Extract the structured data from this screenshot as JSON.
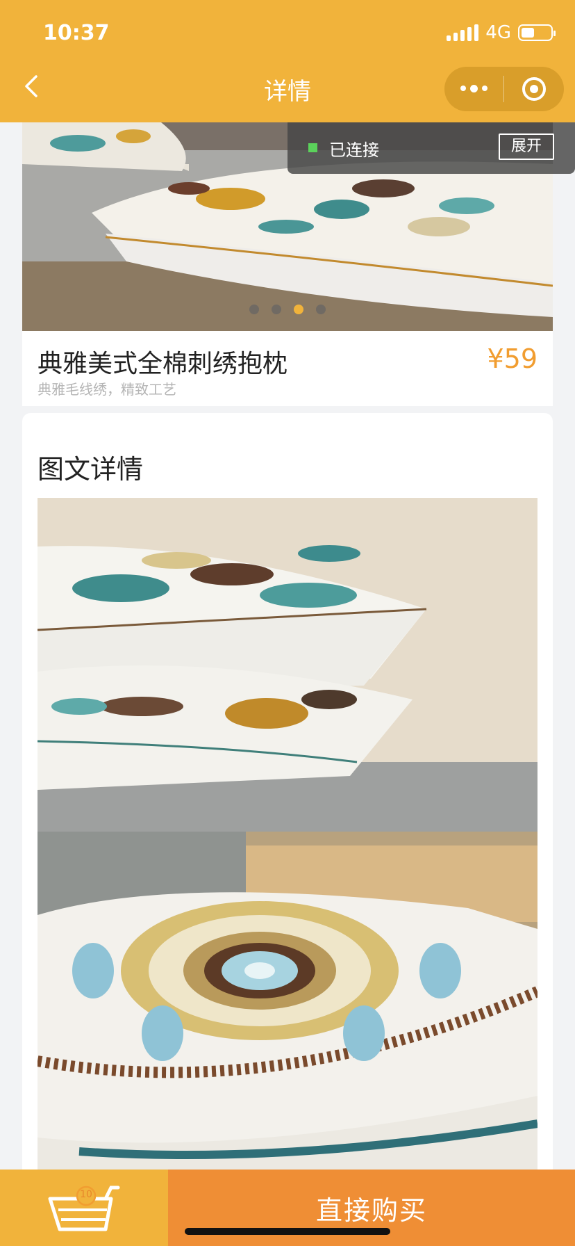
{
  "status_bar": {
    "time": "10:37",
    "network": "4G"
  },
  "nav": {
    "title": "详情"
  },
  "connection": {
    "status_text": "已连接",
    "expand_label": "展开"
  },
  "carousel": {
    "total": 4,
    "active_index": 2
  },
  "product": {
    "title": "典雅美式全棉刺绣抱枕",
    "price": "¥59",
    "subtitle": "典雅毛线绣，精致工艺"
  },
  "detail": {
    "heading": "图文详情"
  },
  "bottom_bar": {
    "cart_count": "10",
    "buy_label": "直接购买"
  },
  "colors": {
    "brand": "#f1b33b",
    "buy": "#ef8e35",
    "price": "#f19d30"
  }
}
